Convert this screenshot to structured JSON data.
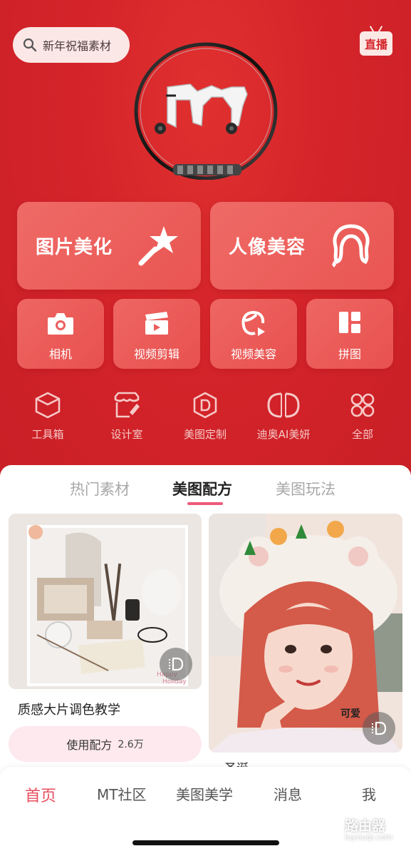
{
  "header": {
    "search_placeholder": "新年祝福素材",
    "live_label": "直播"
  },
  "primary_actions": [
    {
      "label": "图片美化",
      "icon": "magic-wand-star-icon"
    },
    {
      "label": "人像美容",
      "icon": "portrait-hair-icon"
    }
  ],
  "secondary_actions": [
    {
      "label": "相机",
      "icon": "camera-icon"
    },
    {
      "label": "视频剪辑",
      "icon": "clapperboard-icon"
    },
    {
      "label": "视频美容",
      "icon": "video-face-icon"
    },
    {
      "label": "拼图",
      "icon": "collage-grid-icon"
    }
  ],
  "tools": [
    {
      "label": "工具箱",
      "icon": "cube-icon"
    },
    {
      "label": "设计室",
      "icon": "store-pen-icon"
    },
    {
      "label": "美图定制",
      "icon": "custom-d-icon"
    },
    {
      "label": "迪奥AI美妍",
      "icon": "dior-cd-icon"
    },
    {
      "label": "全部",
      "icon": "four-petal-grid-icon"
    }
  ],
  "content_tabs": [
    {
      "label": "热门素材",
      "active": false
    },
    {
      "label": "美图配方",
      "active": true
    },
    {
      "label": "美图玩法",
      "active": false
    }
  ],
  "feed": {
    "card1": {
      "title": "质感大片调色教学",
      "button_label": "使用配方",
      "use_count": "2.6万",
      "sticker_text_1": "Happy",
      "sticker_text_2": "Holiday"
    },
    "card2": {
      "overlay_text": "可爱",
      "partial_title": "圣诞..."
    }
  },
  "bottom_nav": [
    {
      "label": "首页",
      "active": true
    },
    {
      "label": "MT社区",
      "active": false
    },
    {
      "label": "美图美学",
      "active": false
    },
    {
      "label": "消息",
      "active": false
    },
    {
      "label": "我",
      "active": false
    }
  ],
  "watermark": {
    "text": "路由器",
    "sub": "luyouqi.com"
  },
  "colors": {
    "brand_red": "#d8262a",
    "card_red": "#ec5f5c",
    "active_pink": "#e84e5f"
  }
}
